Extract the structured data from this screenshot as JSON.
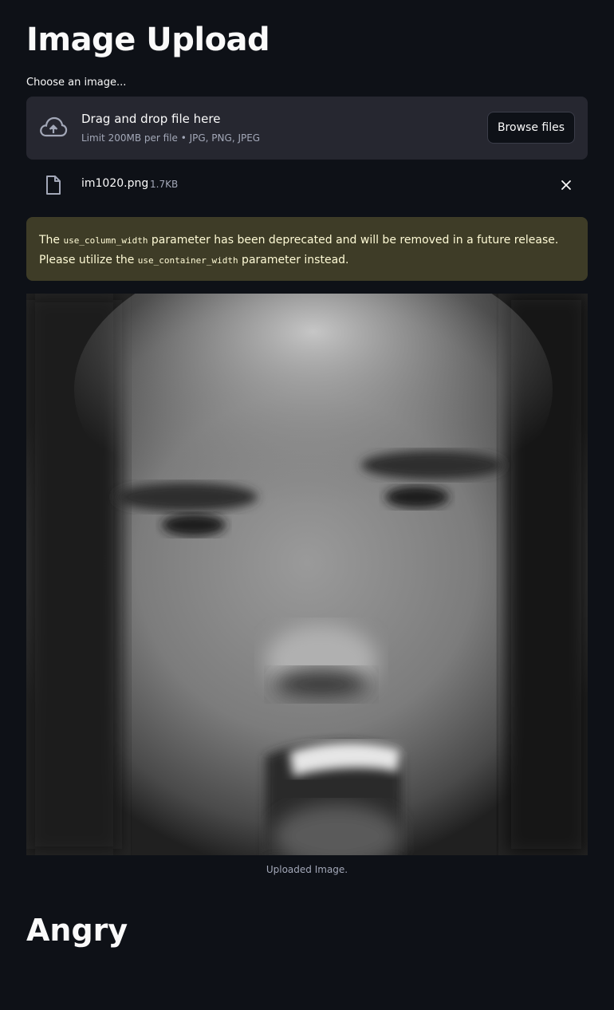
{
  "header": {
    "title": "Image Upload"
  },
  "uploader": {
    "label": "Choose an image...",
    "drop_text": "Drag and drop file here",
    "limit_text": "Limit 200MB per file • JPG, PNG, JPEG",
    "browse_label": "Browse files",
    "icon": "cloud-upload-icon"
  },
  "uploaded_file": {
    "name": "im1020.png",
    "size": "1.7KB",
    "icon": "file-icon",
    "remove_icon": "close-icon"
  },
  "warning": {
    "prefix": "The ",
    "code1": "use_column_width",
    "middle": " parameter has been deprecated and will be removed in a future release. Please utilize the ",
    "code2": "use_container_width",
    "suffix": " parameter instead."
  },
  "image": {
    "caption": "Uploaded Image."
  },
  "result": {
    "label": "Angry"
  },
  "colors": {
    "background": "#0e1117",
    "dropzone": "#262730",
    "warning_bg": "#3e3c27",
    "warning_text": "#fffbd6",
    "muted_text": "#a3a8b8"
  }
}
